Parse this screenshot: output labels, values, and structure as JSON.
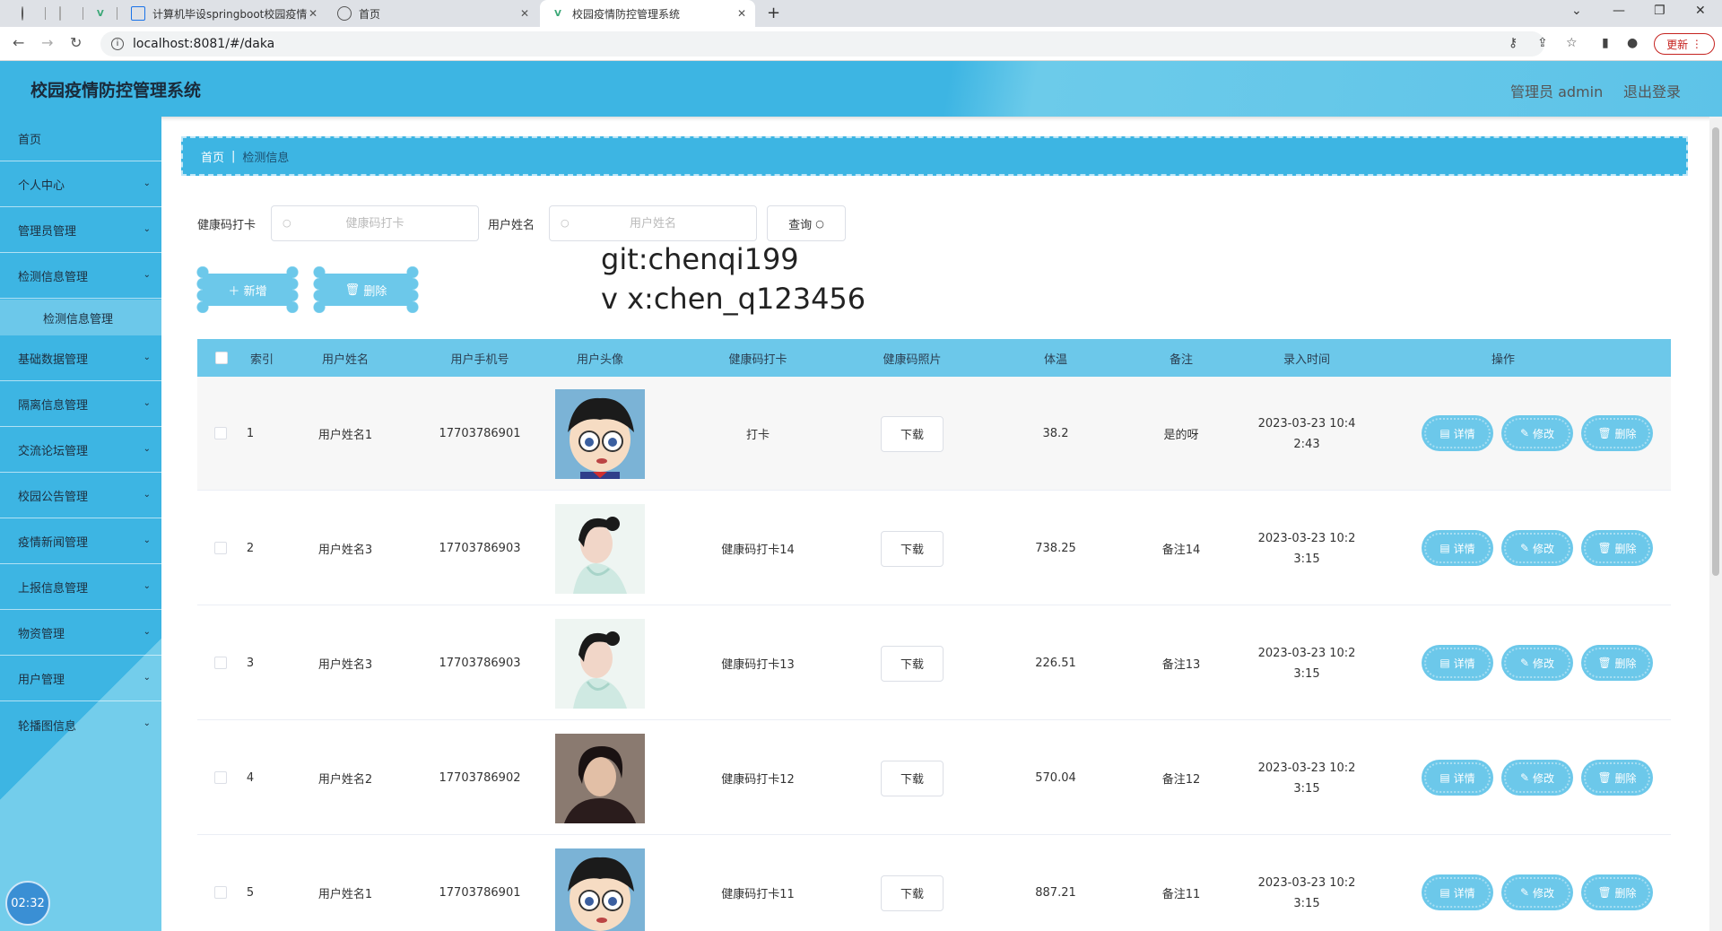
{
  "browser": {
    "tabs": [
      {
        "title": "",
        "active": false
      },
      {
        "title": "",
        "active": false
      },
      {
        "title": "",
        "active": false
      },
      {
        "title": "计算机毕设springboot校园疫情",
        "active": false
      },
      {
        "title": "首页",
        "active": false
      },
      {
        "title": "校园疫情防控管理系统",
        "active": true
      }
    ],
    "url": "localhost:8081/#/daka",
    "update_label": "更新"
  },
  "header": {
    "title": "校园疫情防控管理系统",
    "user": "管理员 admin",
    "logout": "退出登录"
  },
  "sidebar": {
    "items": [
      {
        "label": "首页",
        "has_children": false
      },
      {
        "label": "个人中心",
        "has_children": true
      },
      {
        "label": "管理员管理",
        "has_children": true
      },
      {
        "label": "检测信息管理",
        "has_children": true
      },
      {
        "label": "基础数据管理",
        "has_children": true
      },
      {
        "label": "隔离信息管理",
        "has_children": true
      },
      {
        "label": "交流论坛管理",
        "has_children": true
      },
      {
        "label": "校园公告管理",
        "has_children": true
      },
      {
        "label": "疫情新闻管理",
        "has_children": true
      },
      {
        "label": "上报信息管理",
        "has_children": true
      },
      {
        "label": "物资管理",
        "has_children": true
      },
      {
        "label": "用户管理",
        "has_children": true
      },
      {
        "label": "轮播图信息",
        "has_children": true
      }
    ],
    "sub_item": "检测信息管理",
    "clock": "02:32"
  },
  "breadcrumb": {
    "home": "首页",
    "current": "检测信息"
  },
  "filters": {
    "health_label": "健康码打卡",
    "health_placeholder": "健康码打卡",
    "name_label": "用户姓名",
    "name_placeholder": "用户姓名",
    "search_label": "查询"
  },
  "actions": {
    "add_label": "新增",
    "delete_label": "删除"
  },
  "watermark": {
    "line1": "git:chenqi199",
    "line2": "v x:chen_q123456"
  },
  "table": {
    "headers": [
      "索引",
      "用户姓名",
      "用户手机号",
      "用户头像",
      "健康码打卡",
      "健康码照片",
      "体温",
      "备注",
      "录入时间",
      "操作"
    ],
    "download_label": "下载",
    "op_labels": {
      "detail": "详情",
      "edit": "修改",
      "delete": "删除"
    },
    "rows": [
      {
        "index": "1",
        "name": "用户姓名1",
        "phone": "17703786901",
        "avatar": "cartoon-boy",
        "checkin": "打卡",
        "temp": "38.2",
        "note": "是的呀",
        "time1": "2023-03-23 10:4",
        "time2": "2:43"
      },
      {
        "index": "2",
        "name": "用户姓名3",
        "phone": "17703786903",
        "avatar": "woman-portrait",
        "checkin": "健康码打卡14",
        "temp": "738.25",
        "note": "备注14",
        "time1": "2023-03-23 10:2",
        "time2": "3:15"
      },
      {
        "index": "3",
        "name": "用户姓名3",
        "phone": "17703786903",
        "avatar": "woman-portrait",
        "checkin": "健康码打卡13",
        "temp": "226.51",
        "note": "备注13",
        "time1": "2023-03-23 10:2",
        "time2": "3:15"
      },
      {
        "index": "4",
        "name": "用户姓名2",
        "phone": "17703786902",
        "avatar": "man-portrait",
        "checkin": "健康码打卡12",
        "temp": "570.04",
        "note": "备注12",
        "time1": "2023-03-23 10:2",
        "time2": "3:15"
      },
      {
        "index": "5",
        "name": "用户姓名1",
        "phone": "17703786901",
        "avatar": "cartoon-boy",
        "checkin": "健康码打卡11",
        "temp": "887.21",
        "note": "备注11",
        "time1": "2023-03-23 10:2",
        "time2": "3:15"
      }
    ]
  },
  "colors": {
    "primary": "#3db5e3",
    "light": "#6cc8ea"
  }
}
